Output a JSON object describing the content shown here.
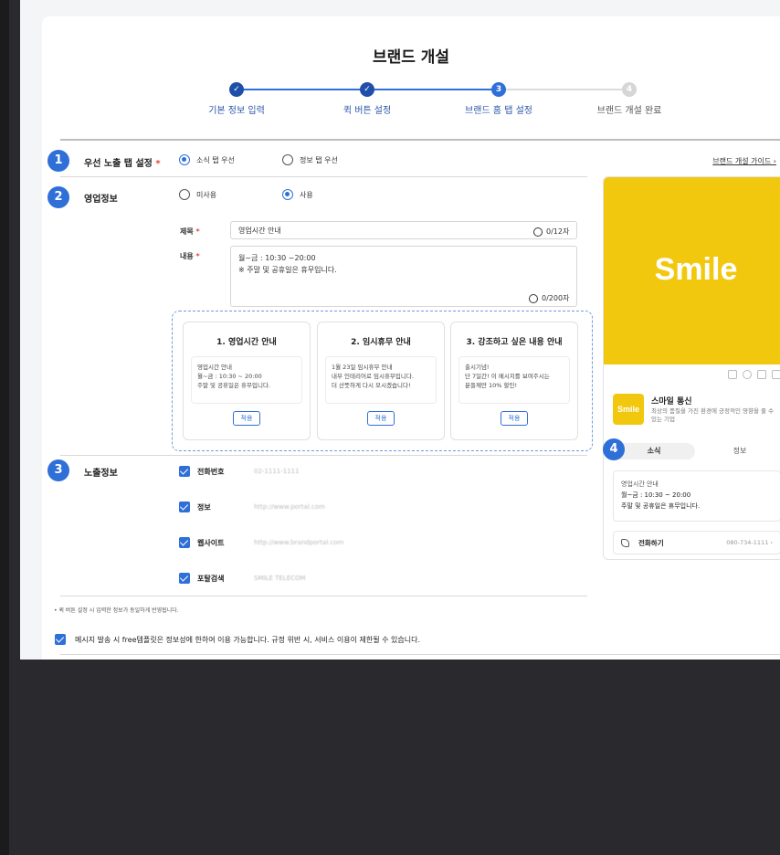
{
  "page_title": "브랜드 개설",
  "steps": [
    {
      "label": "기본 정보 입력",
      "num": "",
      "state": "done"
    },
    {
      "label": "퀵 버튼 설정",
      "num": "",
      "state": "done"
    },
    {
      "label": "브랜드 홈 탭 설정",
      "num": "3",
      "state": "current"
    },
    {
      "label": "브랜드 개설 완료",
      "num": "4",
      "state": "todo"
    }
  ],
  "section1": {
    "badge": "1",
    "label": "우선 노출 탭 설정",
    "required": "*",
    "options": [
      "소식 탭 우선",
      "정보 탭 우선"
    ],
    "selected": "소식 탭 우선",
    "guide_link": "브랜드 개설 가이드 ›"
  },
  "section2": {
    "badge": "2",
    "label": "영업정보",
    "options": [
      "미사용",
      "사용"
    ],
    "selected": "사용",
    "title_label": "제목",
    "title_value": "영업시간 안내",
    "title_counter": "0/12자",
    "content_label": "내용",
    "content_line1": "월~금 : 10:30 ~20:00",
    "content_line2": "※ 주말 및 공휴일은 휴무입니다.",
    "content_counter": "0/200자",
    "templates": [
      {
        "title": "1. 영업시간 안내",
        "lines": [
          "영업시간 안내",
          "월~금 : 10:30 ~ 20:00",
          "주말 및 공휴일은 휴무입니다."
        ],
        "button": "적용"
      },
      {
        "title": "2. 임시휴무 안내",
        "lines": [
          "1월 23일 임시휴무 안내",
          "내부 인테리어로 임시휴무입니다.",
          "더 산뜻하게 다시 모시겠습니다!"
        ],
        "button": "적용"
      },
      {
        "title": "3. 강조하고 싶은 내용 안내",
        "lines": [
          "출시기념!",
          "단 7일간! 이 메시지를 보여주시는",
          "분들께만 10% 할인!"
        ],
        "button": "적용"
      }
    ]
  },
  "section3": {
    "badge": "3",
    "label": "노출정보",
    "items": [
      {
        "label": "전화번호",
        "value": "02-1111-1111"
      },
      {
        "label": "정보",
        "value": "http://www.portal.com"
      },
      {
        "label": "웹사이트",
        "value": "http://www.brandportal.com"
      },
      {
        "label": "포탈검색",
        "value": "SMILE TELECOM"
      }
    ]
  },
  "note": "• 퀵 버튼 설정 시 입력한 정보가 동일하게 반영됩니다.",
  "agree_text": "메시지 발송 시 free템플릿은 정보성에 한하여 이용 가능합니다. 규정 위반 시, 서비스 이용이 제한될 수 있습니다.",
  "preview": {
    "banner_text": "Smile",
    "logo_text": "Smile",
    "brand_name": "스마일 통신",
    "brand_desc": "최상의 품질을 가진 환경에 긍정적인 영향을 줄 수 있는 기업",
    "badge": "4",
    "tabs": [
      "소식",
      "정보"
    ],
    "card_line1": "영업시간 안내",
    "card_line2": "월~금 : 10:30 ~ 20:00",
    "card_line3": "주말 및 공휴일은 휴무입니다.",
    "call_label": "전화하기",
    "call_number": "080-734-1111 ›"
  },
  "colors": {
    "accent": "#2f6fd8",
    "brand_yellow": "#f2c80f"
  }
}
